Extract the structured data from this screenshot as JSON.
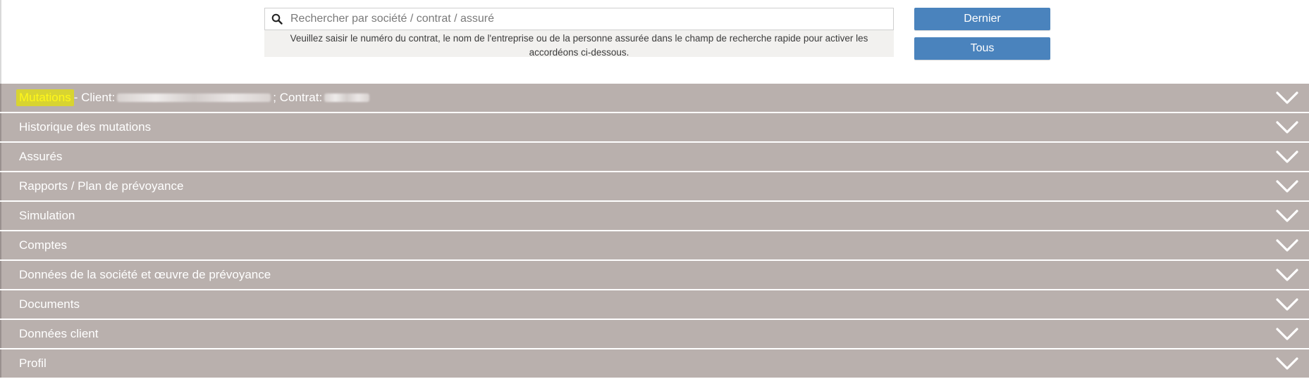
{
  "search": {
    "placeholder": "Rechercher par société / contrat / assuré",
    "value": "",
    "help_text": "Veuillez saisir le numéro du contrat, le nom de l'entreprise ou de la personne assurée dans le champ de recherche rapide pour activer les accordéons ci-dessous.",
    "icon": "search-icon"
  },
  "buttons": {
    "dernier_label": "Dernier",
    "tous_label": "Tous"
  },
  "accordion": {
    "first": {
      "highlight": "Mutations",
      "client_label": " - Client:",
      "contract_label": "; Contrat:"
    },
    "items": [
      {
        "label": "Historique des mutations"
      },
      {
        "label": "Assurés"
      },
      {
        "label": "Rapports / Plan de prévoyance"
      },
      {
        "label": "Simulation"
      },
      {
        "label": "Comptes"
      },
      {
        "label": "Données de la société et œuvre de prévoyance"
      },
      {
        "label": "Documents"
      },
      {
        "label": "Données client"
      },
      {
        "label": "Profil"
      }
    ],
    "chevron_icon": "chevron-down-icon"
  },
  "colors": {
    "accordion_bg": "#b9b0ad",
    "button_bg": "#4a83bd",
    "highlight_bg": "#d8d431",
    "highlight_text": "#fff71a"
  }
}
